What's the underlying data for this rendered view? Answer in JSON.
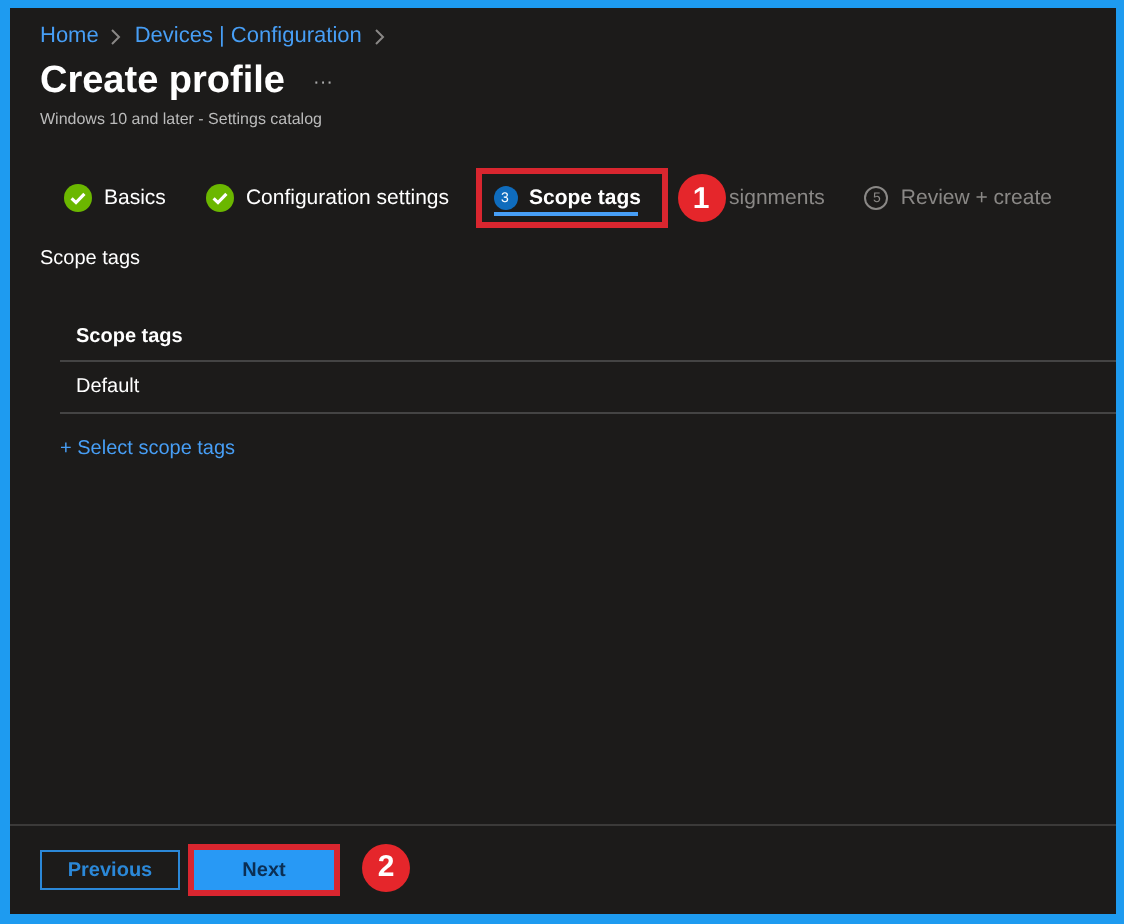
{
  "breadcrumb": [
    {
      "label": "Home"
    },
    {
      "label": "Devices | Configuration"
    }
  ],
  "title": "Create profile",
  "more": "···",
  "subtitle": "Windows 10 and later - Settings catalog",
  "steps": [
    {
      "kind": "done",
      "label": "Basics",
      "selected": false
    },
    {
      "kind": "done",
      "label": "Configuration settings",
      "selected": false
    },
    {
      "kind": "current",
      "number": "3",
      "label": "Scope tags",
      "selected": true,
      "callout": "1"
    },
    {
      "kind": "hidden",
      "label": "signments",
      "selected": false
    },
    {
      "kind": "pending",
      "number": "5",
      "label": "Review + create",
      "selected": false
    }
  ],
  "section_label": "Scope tags",
  "table": {
    "columns": [
      "Scope tags"
    ],
    "rows": [
      [
        "Default"
      ]
    ]
  },
  "link": "+ Select scope tags",
  "buttons": [
    {
      "label": "Previous",
      "kind": "secondary"
    },
    {
      "label": "Next",
      "kind": "primary",
      "callout": "2"
    }
  ]
}
